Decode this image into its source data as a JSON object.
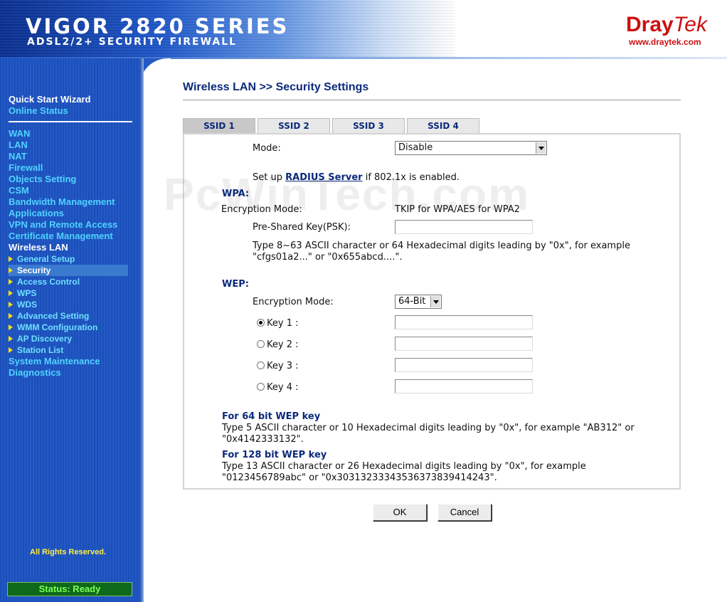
{
  "header": {
    "product": "VIGOR 2820 SERIES",
    "subtitle": "ADSL2/2+ SECURITY FIREWALL",
    "brand_dray": "Dray",
    "brand_tek": "Tek",
    "brand_url": "www.draytek.com"
  },
  "sidebar": {
    "top": [
      "Quick Start Wizard",
      "Online Status"
    ],
    "items": [
      "WAN",
      "LAN",
      "NAT",
      "Firewall",
      "Objects Setting",
      "CSM",
      "Bandwidth Management",
      "Applications",
      "VPN and Remote Access",
      "Certificate Management",
      "Wireless LAN"
    ],
    "wireless_sub": [
      "General Setup",
      "Security",
      "Access Control",
      "WPS",
      "WDS",
      "Advanced Setting",
      "WMM Configuration",
      "AP Discovery",
      "Station List"
    ],
    "bottom": [
      "System Maintenance",
      "Diagnostics"
    ],
    "selected_sub": "Security",
    "copyright": "All Rights Reserved.",
    "status": "Status: Ready"
  },
  "page": {
    "title": "Wireless LAN >> Security Settings",
    "tabs": [
      "SSID 1",
      "SSID 2",
      "SSID 3",
      "SSID 4"
    ],
    "active_tab": "SSID 1",
    "mode_label": "Mode:",
    "mode_value": "Disable",
    "radius_prefix": "Set up",
    "radius_link": "RADIUS Server",
    "radius_suffix": "if 802.1x is enabled.",
    "wpa_heading": "WPA:",
    "wpa_enc_label": "Encryption Mode:",
    "wpa_enc_value": "TKIP for WPA/AES for WPA2",
    "psk_label": "Pre-Shared Key(PSK):",
    "psk_value": "",
    "psk_help_1": "Type 8~63 ASCII character or 64 Hexadecimal digits leading by \"0x\", for example",
    "psk_help_2": "\"cfgs01a2...\" or \"0x655abcd....\".",
    "wep_heading": "WEP:",
    "wep_enc_label": "Encryption Mode:",
    "wep_enc_value": "64-Bit",
    "keys": [
      {
        "label": "Key 1 :",
        "selected": true,
        "value": ""
      },
      {
        "label": "Key 2 :",
        "selected": false,
        "value": ""
      },
      {
        "label": "Key 3 :",
        "selected": false,
        "value": ""
      },
      {
        "label": "Key 4 :",
        "selected": false,
        "value": ""
      }
    ],
    "wep64_heading": "For 64 bit WEP key",
    "wep64_help_1": "Type 5 ASCII character or 10 Hexadecimal digits leading by \"0x\", for example \"AB312\" or",
    "wep64_help_2": "\"0x4142333132\".",
    "wep128_heading": "For 128 bit WEP key",
    "wep128_help_1": "Type 13 ASCII character or 26 Hexadecimal digits leading by \"0x\", for example",
    "wep128_help_2": "\"0123456789abc\" or \"0x30313233343536373839414243\".",
    "ok_label": "OK",
    "cancel_label": "Cancel",
    "watermark": "PcWinTech.com"
  },
  "colors": {
    "accent_navy": "#0b2a7a",
    "sidebar_blue": "#2359c6",
    "nav_cyan": "#4fd3ff",
    "brand_red": "#cc1010",
    "status_green": "#7dff5a"
  }
}
